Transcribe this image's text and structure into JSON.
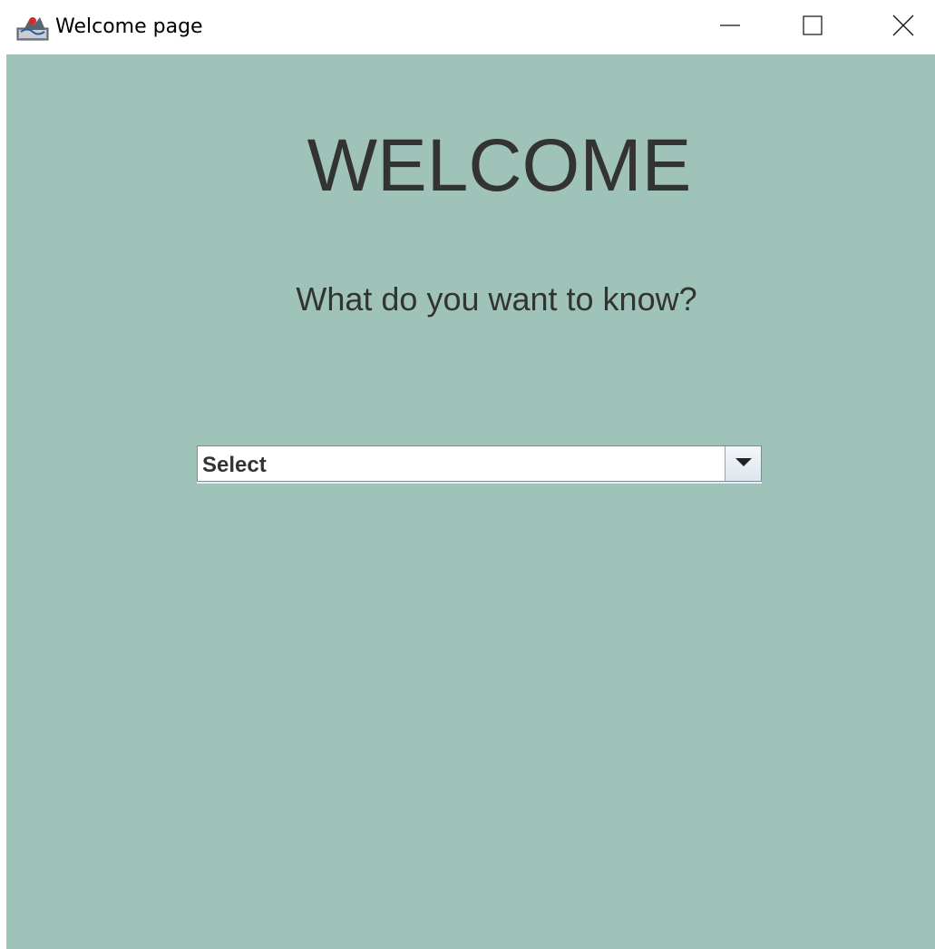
{
  "window": {
    "title": "Welcome page",
    "app_icon": "java-icon",
    "controls": {
      "minimize_icon": "minimize-icon",
      "maximize_icon": "maximize-icon",
      "close_icon": "close-icon"
    }
  },
  "main": {
    "heading": "WELCOME",
    "question": "What do you want to know?",
    "dropdown": {
      "selected": "Select",
      "arrow_icon": "chevron-down-icon"
    }
  },
  "colors": {
    "background": "#a0c3b9",
    "text": "#333333",
    "titlebar": "#ffffff"
  }
}
